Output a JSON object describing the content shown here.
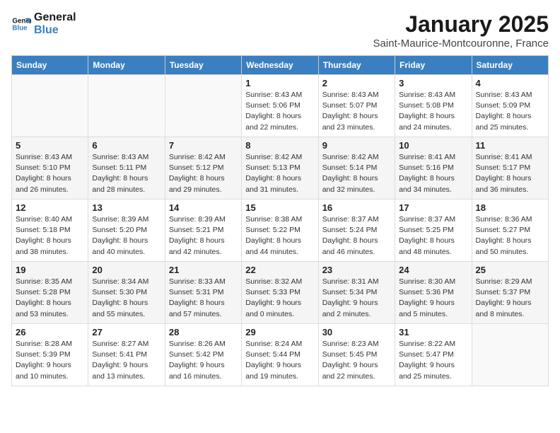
{
  "header": {
    "logo_line1": "General",
    "logo_line2": "Blue",
    "month_title": "January 2025",
    "location": "Saint-Maurice-Montcouronne, France"
  },
  "weekdays": [
    "Sunday",
    "Monday",
    "Tuesday",
    "Wednesday",
    "Thursday",
    "Friday",
    "Saturday"
  ],
  "weeks": [
    [
      {
        "day": "",
        "info": ""
      },
      {
        "day": "",
        "info": ""
      },
      {
        "day": "",
        "info": ""
      },
      {
        "day": "1",
        "info": "Sunrise: 8:43 AM\nSunset: 5:06 PM\nDaylight: 8 hours\nand 22 minutes."
      },
      {
        "day": "2",
        "info": "Sunrise: 8:43 AM\nSunset: 5:07 PM\nDaylight: 8 hours\nand 23 minutes."
      },
      {
        "day": "3",
        "info": "Sunrise: 8:43 AM\nSunset: 5:08 PM\nDaylight: 8 hours\nand 24 minutes."
      },
      {
        "day": "4",
        "info": "Sunrise: 8:43 AM\nSunset: 5:09 PM\nDaylight: 8 hours\nand 25 minutes."
      }
    ],
    [
      {
        "day": "5",
        "info": "Sunrise: 8:43 AM\nSunset: 5:10 PM\nDaylight: 8 hours\nand 26 minutes."
      },
      {
        "day": "6",
        "info": "Sunrise: 8:43 AM\nSunset: 5:11 PM\nDaylight: 8 hours\nand 28 minutes."
      },
      {
        "day": "7",
        "info": "Sunrise: 8:42 AM\nSunset: 5:12 PM\nDaylight: 8 hours\nand 29 minutes."
      },
      {
        "day": "8",
        "info": "Sunrise: 8:42 AM\nSunset: 5:13 PM\nDaylight: 8 hours\nand 31 minutes."
      },
      {
        "day": "9",
        "info": "Sunrise: 8:42 AM\nSunset: 5:14 PM\nDaylight: 8 hours\nand 32 minutes."
      },
      {
        "day": "10",
        "info": "Sunrise: 8:41 AM\nSunset: 5:16 PM\nDaylight: 8 hours\nand 34 minutes."
      },
      {
        "day": "11",
        "info": "Sunrise: 8:41 AM\nSunset: 5:17 PM\nDaylight: 8 hours\nand 36 minutes."
      }
    ],
    [
      {
        "day": "12",
        "info": "Sunrise: 8:40 AM\nSunset: 5:18 PM\nDaylight: 8 hours\nand 38 minutes."
      },
      {
        "day": "13",
        "info": "Sunrise: 8:39 AM\nSunset: 5:20 PM\nDaylight: 8 hours\nand 40 minutes."
      },
      {
        "day": "14",
        "info": "Sunrise: 8:39 AM\nSunset: 5:21 PM\nDaylight: 8 hours\nand 42 minutes."
      },
      {
        "day": "15",
        "info": "Sunrise: 8:38 AM\nSunset: 5:22 PM\nDaylight: 8 hours\nand 44 minutes."
      },
      {
        "day": "16",
        "info": "Sunrise: 8:37 AM\nSunset: 5:24 PM\nDaylight: 8 hours\nand 46 minutes."
      },
      {
        "day": "17",
        "info": "Sunrise: 8:37 AM\nSunset: 5:25 PM\nDaylight: 8 hours\nand 48 minutes."
      },
      {
        "day": "18",
        "info": "Sunrise: 8:36 AM\nSunset: 5:27 PM\nDaylight: 8 hours\nand 50 minutes."
      }
    ],
    [
      {
        "day": "19",
        "info": "Sunrise: 8:35 AM\nSunset: 5:28 PM\nDaylight: 8 hours\nand 53 minutes."
      },
      {
        "day": "20",
        "info": "Sunrise: 8:34 AM\nSunset: 5:30 PM\nDaylight: 8 hours\nand 55 minutes."
      },
      {
        "day": "21",
        "info": "Sunrise: 8:33 AM\nSunset: 5:31 PM\nDaylight: 8 hours\nand 57 minutes."
      },
      {
        "day": "22",
        "info": "Sunrise: 8:32 AM\nSunset: 5:33 PM\nDaylight: 9 hours\nand 0 minutes."
      },
      {
        "day": "23",
        "info": "Sunrise: 8:31 AM\nSunset: 5:34 PM\nDaylight: 9 hours\nand 2 minutes."
      },
      {
        "day": "24",
        "info": "Sunrise: 8:30 AM\nSunset: 5:36 PM\nDaylight: 9 hours\nand 5 minutes."
      },
      {
        "day": "25",
        "info": "Sunrise: 8:29 AM\nSunset: 5:37 PM\nDaylight: 9 hours\nand 8 minutes."
      }
    ],
    [
      {
        "day": "26",
        "info": "Sunrise: 8:28 AM\nSunset: 5:39 PM\nDaylight: 9 hours\nand 10 minutes."
      },
      {
        "day": "27",
        "info": "Sunrise: 8:27 AM\nSunset: 5:41 PM\nDaylight: 9 hours\nand 13 minutes."
      },
      {
        "day": "28",
        "info": "Sunrise: 8:26 AM\nSunset: 5:42 PM\nDaylight: 9 hours\nand 16 minutes."
      },
      {
        "day": "29",
        "info": "Sunrise: 8:24 AM\nSunset: 5:44 PM\nDaylight: 9 hours\nand 19 minutes."
      },
      {
        "day": "30",
        "info": "Sunrise: 8:23 AM\nSunset: 5:45 PM\nDaylight: 9 hours\nand 22 minutes."
      },
      {
        "day": "31",
        "info": "Sunrise: 8:22 AM\nSunset: 5:47 PM\nDaylight: 9 hours\nand 25 minutes."
      },
      {
        "day": "",
        "info": ""
      }
    ]
  ]
}
